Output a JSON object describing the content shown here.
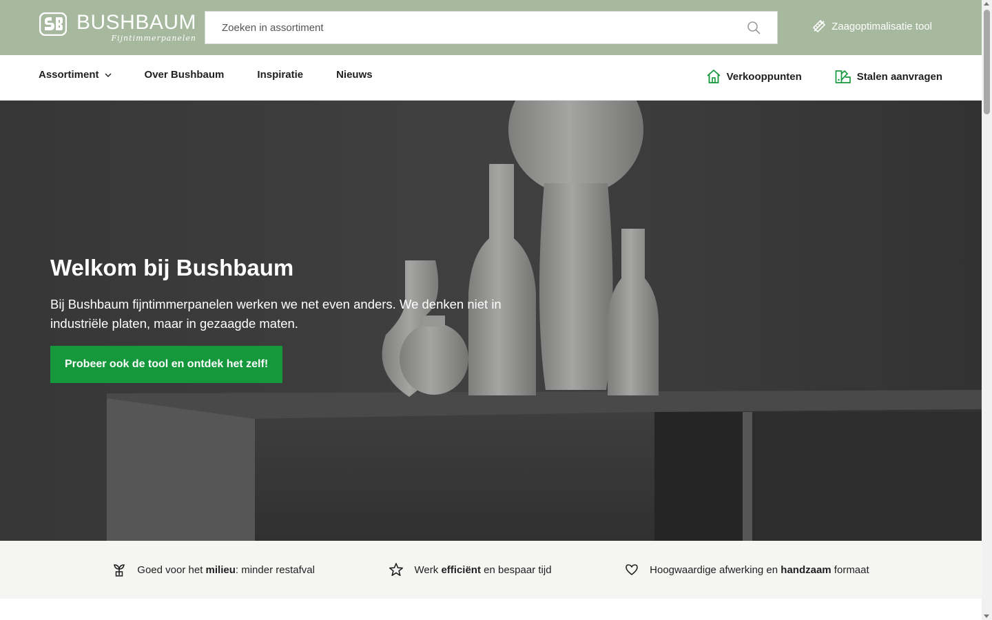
{
  "header": {
    "logo_name": "BUSHBAUM",
    "logo_tagline": "Fijntimmerpanelen",
    "search_placeholder": "Zoeken in assortiment",
    "tool_link": "Zaagoptimalisatie tool"
  },
  "nav": {
    "items": [
      {
        "label": "Assortiment",
        "has_dropdown": true
      },
      {
        "label": "Over Bushbaum"
      },
      {
        "label": "Inspiratie"
      },
      {
        "label": "Nieuws"
      }
    ],
    "right": [
      {
        "label": "Verkooppunten",
        "icon": "home-icon"
      },
      {
        "label": "Stalen aanvragen",
        "icon": "samples-icon"
      }
    ]
  },
  "hero": {
    "title": "Welkom bij Bushbaum",
    "text": "Bij Bushbaum fijntimmerpanelen werken we net even anders. We denken niet in industriële platen, maar in gezaagde maten.",
    "cta": "Probeer ook de tool en ontdek het zelf!"
  },
  "usps": [
    {
      "icon": "plant-icon",
      "pre": "Goed voor het ",
      "bold": "milieu",
      "post": ": minder restafval"
    },
    {
      "icon": "star-icon",
      "pre": "Werk ",
      "bold": "efficiënt",
      "post": " en bespaar tijd"
    },
    {
      "icon": "heart-icon",
      "pre": "Hoogwaardige afwerking en ",
      "bold": "handzaam",
      "post": " formaat"
    }
  ],
  "colors": {
    "header_bg": "#a6b89d",
    "accent_green": "#15973b",
    "usp_bg": "#f5f5f3"
  }
}
